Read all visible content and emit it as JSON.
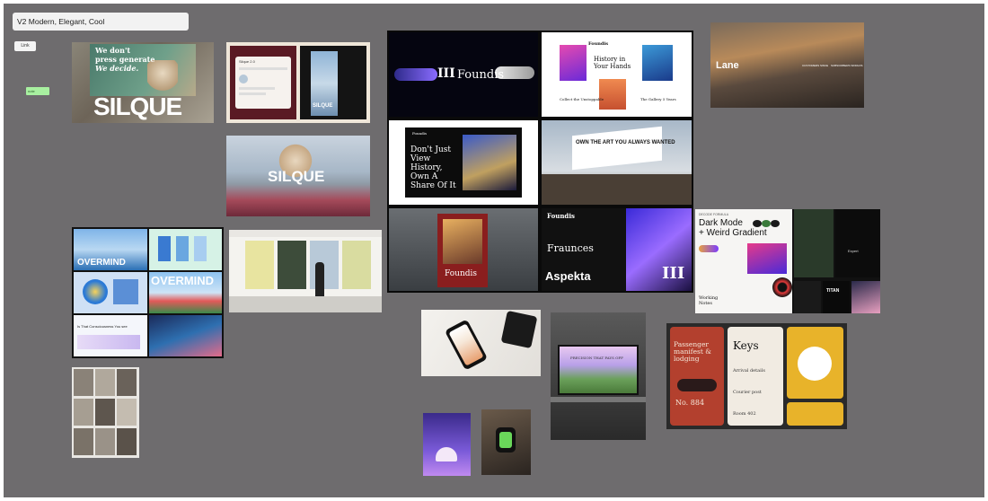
{
  "board": {
    "title": "V2 Modern, Elegant, Cool",
    "mini_card_label": "Link",
    "sticky_label": "note"
  },
  "silque": {
    "billboard_line1": "We don't",
    "billboard_line2": "press generate",
    "billboard_line3": "We decide.",
    "wordmark": "SILQUE",
    "cloud_wordmark": "SILQUE",
    "ui_card_title": "Silque 2.0",
    "bus_stop_word": "SILQUE"
  },
  "overmind": {
    "wordmark": "OVERMIND",
    "wordmark_large": "OVERMIND",
    "web_heading": "Is That Consciousness You see"
  },
  "foundis": {
    "brand": "Foundis",
    "monogram": "III",
    "book_title": "History in Your Hands",
    "book_caption_left": "Collect the Unstoppable",
    "book_caption_right": "The Gallery 5 Years",
    "poster_headline_1": "Don't Just",
    "poster_headline_2": "View",
    "poster_headline_3": "History,",
    "poster_headline_4": "Own A",
    "poster_headline_5": "Share Of It",
    "billboard_text": "OWN THE ART YOU ALWAYS WANTED",
    "fraunces": "Fraunces",
    "aspekta": "Aspekta"
  },
  "lane": {
    "logo": "Lane",
    "col1": "CUSTOMERS SINCE",
    "col2": "SUBSCRIBERS WORLDS"
  },
  "dark_mode": {
    "eyebrow": "DECODE FORMULA",
    "title_line1": "Dark Mode",
    "title_line2": "+ Weird Gradient",
    "footer_brand": "Working Notes",
    "titan": "TITAN",
    "expert": "Expert"
  },
  "precision": {
    "laptop_headline": "PRECISION THAT PAYS OFF"
  },
  "passenger": {
    "card1_title": "Passenger manifest & lodging",
    "card1_number": "No. 884",
    "card2_title": "Keys",
    "card2_line1": "Arrival details",
    "card2_line2": "Courier post",
    "card2_line3": "Room 402"
  },
  "colors": {
    "canvas": "#6e6c6e",
    "foundis_bg": "#0a0a0a",
    "dark_mode_accent": "#7a3cff",
    "passenger_red": "#b3402e",
    "keys_yellow": "#e8b32a"
  }
}
